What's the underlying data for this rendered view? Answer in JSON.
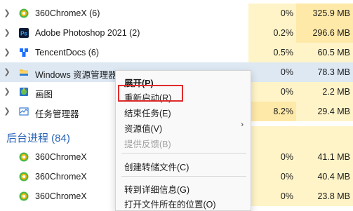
{
  "processes": [
    {
      "name": "360ChromeX (6)",
      "cpu": "0%",
      "mem": "325.9 MB",
      "icon": "360-browser-icon",
      "expandable": true
    },
    {
      "name": "Adobe Photoshop 2021 (2)",
      "cpu": "0.2%",
      "mem": "296.6 MB",
      "icon": "photoshop-icon",
      "expandable": true
    },
    {
      "name": "TencentDocs (6)",
      "cpu": "0.5%",
      "mem": "60.5 MB",
      "icon": "tencent-docs-icon",
      "expandable": true
    },
    {
      "name": "Windows 资源管理器",
      "cpu": "0%",
      "mem": "78.3 MB",
      "icon": "folder-icon",
      "expandable": true,
      "selected": true
    },
    {
      "name": "画图",
      "cpu": "0%",
      "mem": "2.2 MB",
      "icon": "paint-icon",
      "expandable": true
    },
    {
      "name": "任务管理器",
      "cpu": "8.2%",
      "mem": "29.4 MB",
      "icon": "task-manager-icon",
      "expandable": true
    }
  ],
  "background_section": {
    "title": "后台进程 (84)"
  },
  "background_processes": [
    {
      "name": "360ChromeX",
      "cpu": "0%",
      "mem": "41.1 MB",
      "icon": "360-browser-icon"
    },
    {
      "name": "360ChromeX",
      "cpu": "0%",
      "mem": "40.4 MB",
      "icon": "360-browser-icon"
    },
    {
      "name": "360ChromeX",
      "cpu": "0%",
      "mem": "23.8 MB",
      "icon": "360-browser-icon"
    }
  ],
  "context_menu": {
    "items": [
      {
        "label": "展开(P)",
        "bold": true
      },
      {
        "label": "重新启动(R)",
        "highlighted": true
      },
      {
        "label": "结束任务(E)"
      },
      {
        "label": "资源值(V)",
        "submenu": true,
        "arrow": "›"
      },
      {
        "label": "提供反馈(B)",
        "disabled": true
      },
      {
        "label": "创建转储文件(C)"
      },
      {
        "label": "转到详细信息(G)"
      },
      {
        "label": "打开文件所在的位置(O)"
      }
    ]
  },
  "colors": {
    "cpu_heat": "#fff4c8",
    "cpu_heat_strong": "#ffe9a8",
    "mem_heat": "#fff4c8",
    "selected": "#dde8f3",
    "highlight_border": "#e02c2c",
    "section_title": "#2b64b8"
  }
}
